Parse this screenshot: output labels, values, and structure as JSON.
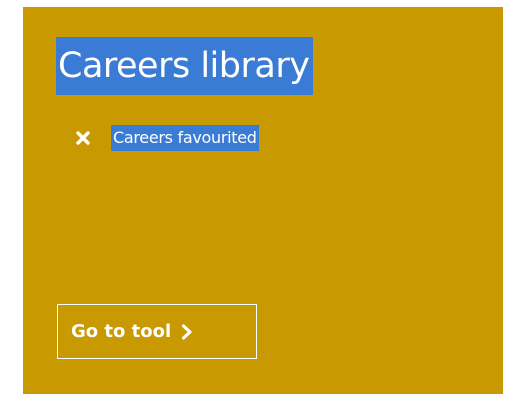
{
  "card": {
    "title": "Careers library",
    "status": {
      "icon": "close-icon",
      "label": "Careers favourited"
    },
    "button": {
      "label": "Go to tool",
      "icon": "chevron-right-icon"
    }
  },
  "colors": {
    "card_background": "#c89900",
    "selection_highlight": "#3a7bd5",
    "text": "#ffffff"
  }
}
